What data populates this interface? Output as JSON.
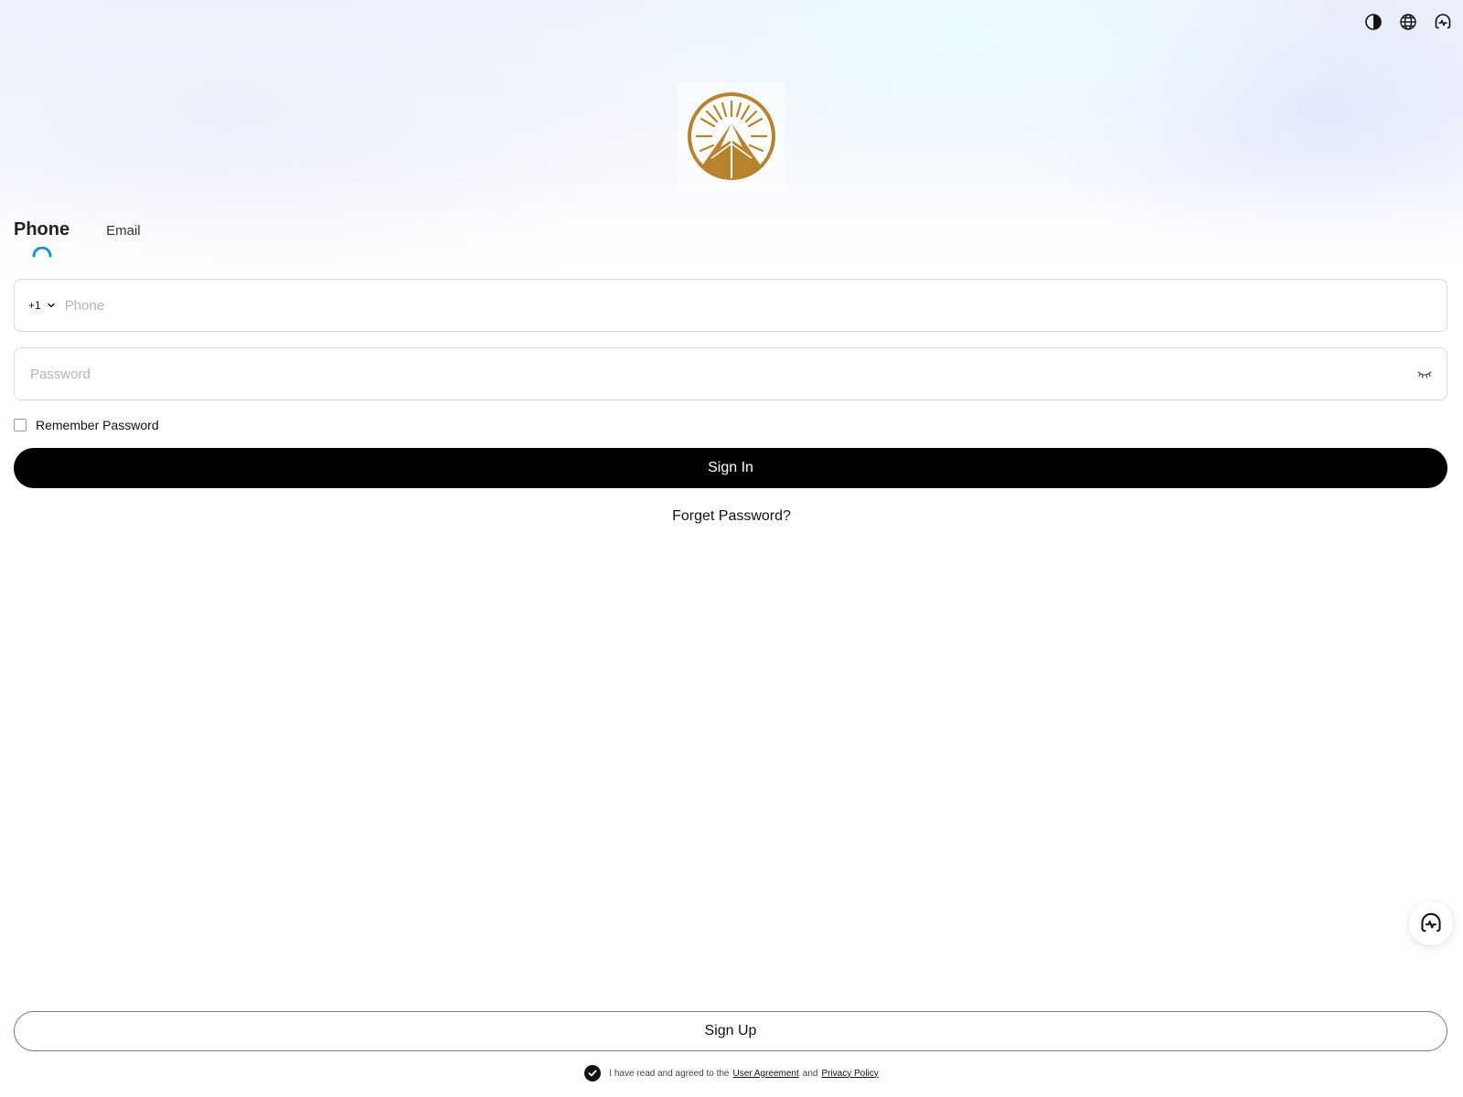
{
  "header": {
    "icons": [
      "theme-contrast-icon",
      "language-globe-icon",
      "customer-service-icon"
    ]
  },
  "brand": {
    "logo_color": "#B8832F"
  },
  "tabs": [
    {
      "label": "Phone",
      "active": true
    },
    {
      "label": "Email",
      "active": false
    }
  ],
  "form": {
    "country_code": "+1",
    "phone_placeholder": "Phone",
    "phone_value": "",
    "password_placeholder": "Password",
    "password_value": "",
    "remember_label": "Remember Password",
    "remember_checked": false,
    "signin_label": "Sign In",
    "forget_label": "Forget Password?",
    "signup_label": "Sign Up"
  },
  "agreement": {
    "checked": true,
    "prefix": "I have read and agreed to the",
    "user_agreement": "User Agreement",
    "and": "and",
    "privacy_policy": "Privacy Policy"
  },
  "colors": {
    "accent": "#1E90D6",
    "primary_button": "#000000"
  }
}
